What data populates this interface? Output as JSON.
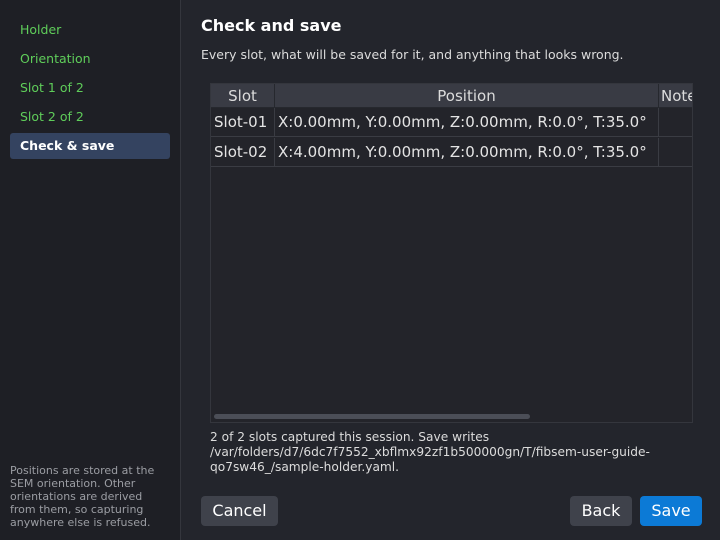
{
  "sidebar": {
    "items": [
      {
        "label": "Holder"
      },
      {
        "label": "Orientation"
      },
      {
        "label": "Slot 1 of 2"
      },
      {
        "label": "Slot 2 of 2"
      },
      {
        "label": "Check & save"
      }
    ],
    "note": "Positions are stored at the SEM orientation. Other orientations are derived from them, so capturing anywhere else is refused."
  },
  "main": {
    "title": "Check and save",
    "subtitle": "Every slot, what will be saved for it, and anything that looks wrong.",
    "table": {
      "columns": [
        "Slot",
        "Position",
        "Notes"
      ],
      "rows": [
        {
          "slot": "Slot-01",
          "position": "X:0.00mm, Y:0.00mm, Z:0.00mm, R:0.0°, T:35.0°",
          "notes": ""
        },
        {
          "slot": "Slot-02",
          "position": "X:4.00mm, Y:0.00mm, Z:0.00mm, R:0.0°, T:35.0°",
          "notes": ""
        }
      ]
    },
    "status": "2 of 2 slots captured this session. Save writes /var/folders/d7/6dc7f7552_xbflmx92zf1b500000gn/T/fibsem-user-guide-qo7sw46_/sample-holder.yaml."
  },
  "buttons": {
    "cancel": "Cancel",
    "back": "Back",
    "save": "Save"
  },
  "colors": {
    "accent": "#0c7ad6",
    "nav_text": "#5fcd5a",
    "active_bg": "#344360"
  }
}
